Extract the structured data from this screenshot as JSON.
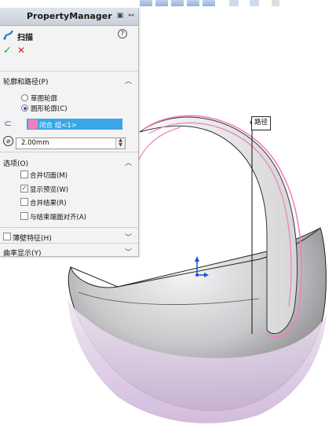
{
  "property_manager": {
    "title": "PropertyManager",
    "feature_name": "扫描",
    "ok_icon": "green-checkmark",
    "cancel_icon": "red-x",
    "help_icon": "question-circle"
  },
  "profile_path_section": {
    "title": "轮廓和路径(P)",
    "radio_sketch": "草图轮廓",
    "radio_circle": "圆形轮廓(C)",
    "path_value": "闭合 组<1>",
    "diameter_value": "2.00mm"
  },
  "options_section": {
    "title": "选项(O)",
    "merge_tangent": "合并切面(M)",
    "show_preview": "显示预览(W)",
    "merge_result": "合并结果(R)",
    "align_end_faces": "与结束端面对齐(A)"
  },
  "thin_feature": {
    "label": "薄壁特征(H)"
  },
  "curvature_display": {
    "label": "曲率显示(Y)"
  },
  "viewport": {
    "path_marker_label": "路径",
    "colors": {
      "profile_pink": "#f07fc0",
      "selection_blue": "#3aa6e6",
      "annotation_red": "#d81e1e"
    }
  }
}
